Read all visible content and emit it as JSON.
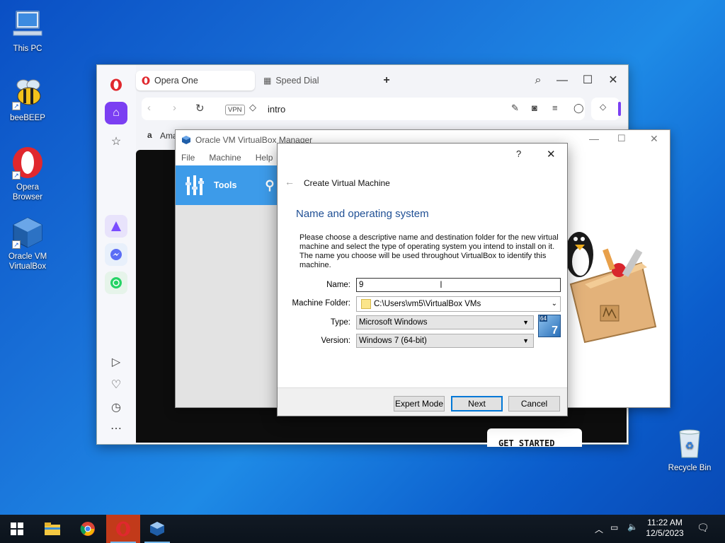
{
  "desktop": {
    "icons": [
      {
        "label": "This PC"
      },
      {
        "label": "beeBEEP"
      },
      {
        "label": "Opera Browser"
      },
      {
        "label": "Oracle VM VirtualBox"
      },
      {
        "label": "Recycle Bin"
      }
    ]
  },
  "opera": {
    "tabs": [
      {
        "label": "Opera One"
      },
      {
        "label": "Speed Dial"
      }
    ],
    "address": {
      "vpn": "VPN",
      "value": "intro"
    },
    "bookmark": "Ama",
    "page_button": "GET STARTED"
  },
  "vbox_manager": {
    "title": "Oracle VM VirtualBox Manager",
    "menu": [
      "File",
      "Machine",
      "Help"
    ],
    "tools_label": "Tools"
  },
  "dialog": {
    "help": "?",
    "header": "Create Virtual Machine",
    "section_title": "Name and operating system",
    "description": "Please choose a descriptive name and destination folder for the new virtual machine and select the type of operating system you intend to install on it. The name you choose will be used throughout VirtualBox to identify this machine.",
    "fields": {
      "name_label": "Name:",
      "name_value": "9",
      "folder_label": "Machine Folder:",
      "folder_value": "C:\\Users\\vm5\\VirtualBox VMs",
      "type_label": "Type:",
      "type_value": "Microsoft Windows",
      "version_label": "Version:",
      "version_value": "Windows 7 (64-bit)"
    },
    "os_badge": {
      "bits": "64",
      "num": "7"
    },
    "buttons": {
      "expert": "Expert Mode",
      "next": "Next",
      "cancel": "Cancel"
    }
  },
  "taskbar": {
    "time": "11:22 AM",
    "date": "12/5/2023"
  },
  "colors": {
    "accent_blue": "#0078d7",
    "vbox_tools": "#3d9be9",
    "opera_red": "#e0282e",
    "dialog_title": "#1f4f94"
  }
}
